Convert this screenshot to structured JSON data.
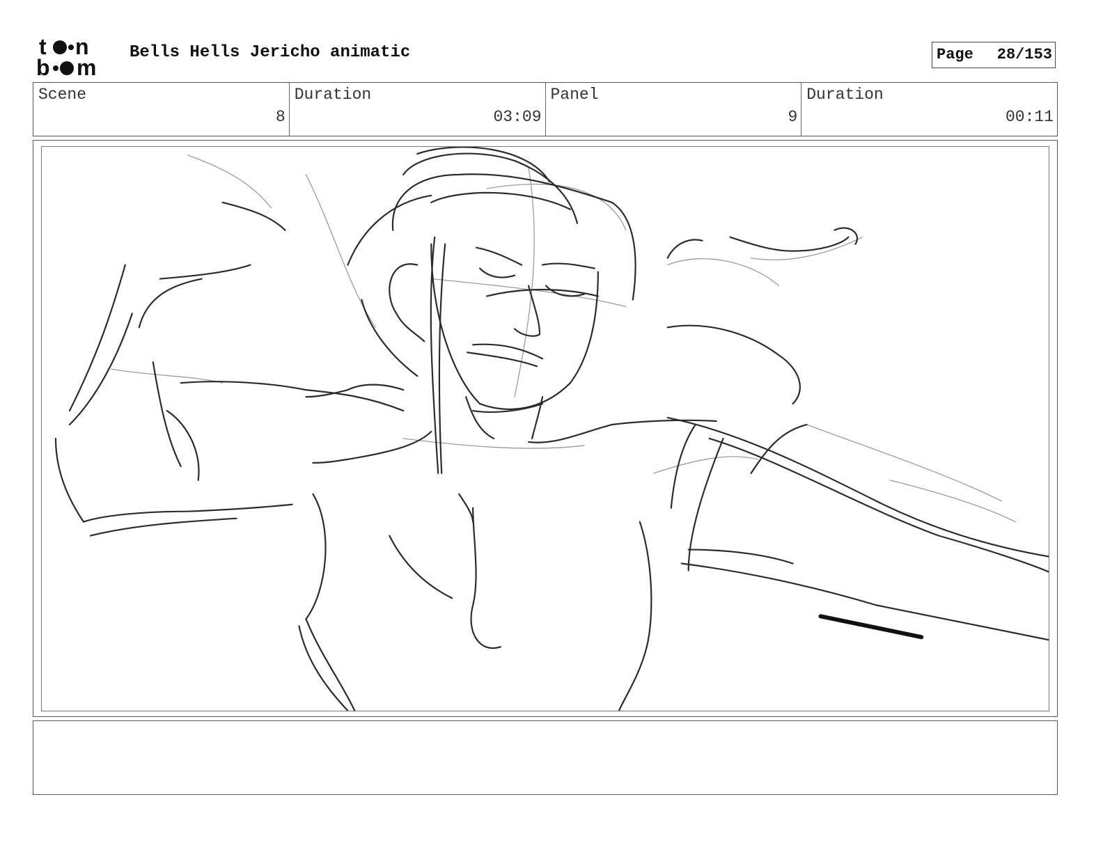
{
  "logo": {
    "line1": "t  n",
    "line2": "b   m",
    "icon": "toonboom-logo"
  },
  "document": {
    "title": "Bells Hells Jericho animatic"
  },
  "page": {
    "label": "Page",
    "number": "28/153"
  },
  "info": {
    "scene_label": "Scene",
    "scene_value": "8",
    "scene_duration_label": "Duration",
    "scene_duration_value": "03:09",
    "panel_label": "Panel",
    "panel_value": "9",
    "panel_duration_label": "Duration",
    "panel_duration_value": "00:11"
  },
  "panel": {
    "image": "pencil sketch of character with arms outstretched, eyes closed"
  },
  "notes": {
    "text": ""
  }
}
